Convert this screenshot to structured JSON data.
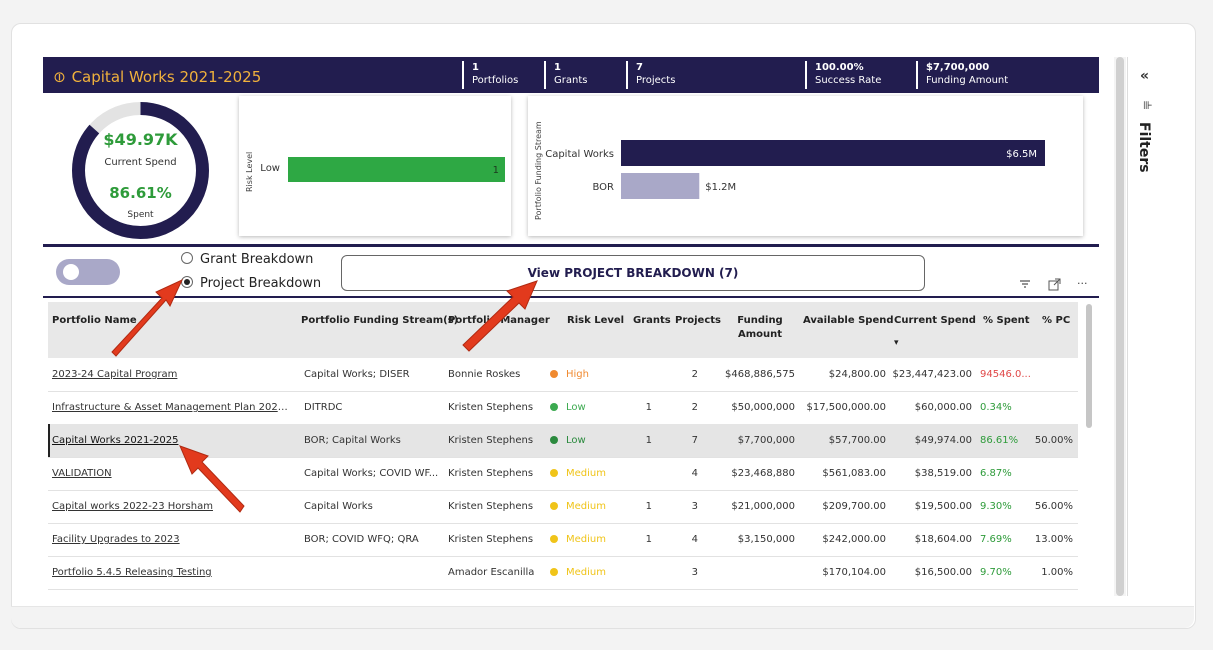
{
  "header": {
    "title": "Capital Works 2021-2025",
    "stats": [
      {
        "value": "1",
        "label": "Portfolios"
      },
      {
        "value": "1",
        "label": "Grants"
      },
      {
        "value": "7",
        "label": "Projects"
      },
      {
        "value": "100.00%",
        "label": "Success Rate"
      },
      {
        "value": "$7,700,000",
        "label": "Funding Amount"
      }
    ]
  },
  "donut": {
    "value": "$49.97K",
    "value_label": "Current Spend",
    "percent": "86.61%",
    "percent_label": "Spent",
    "fraction": 0.8661
  },
  "chart_data": [
    {
      "type": "bar",
      "orientation": "horizontal",
      "ylabel": "Risk Level",
      "categories": [
        "Low"
      ],
      "values": [
        1
      ],
      "data_labels": [
        "1"
      ],
      "xlim": [
        0,
        1
      ],
      "color": "#2ea844"
    },
    {
      "type": "bar",
      "orientation": "horizontal",
      "ylabel": "Portfolio Funding Stream",
      "categories": [
        "Capital Works",
        "BOR"
      ],
      "values": [
        6.5,
        1.2
      ],
      "data_labels": [
        "$6.5M",
        "$1.2M"
      ],
      "xlim": [
        0,
        6.5
      ],
      "colors": [
        "#221d4f",
        "#a9a8c8"
      ]
    }
  ],
  "controls": {
    "radio_grant": "Grant Breakdown",
    "radio_project": "Project Breakdown",
    "view_button": "View PROJECT BREAKDOWN (7)"
  },
  "toolbar": {
    "filter_icon": "filter-icon",
    "focus_icon": "focus-mode-icon",
    "more_icon": "more-options-icon",
    "more": "···"
  },
  "table": {
    "columns": [
      "Portfolio Name",
      "Portfolio Funding Stream(s)",
      "Portfolio Manager",
      "Risk Level",
      "Grants",
      "Projects",
      "Funding Amount",
      "Available Spend",
      "Current Spend",
      "% Spent",
      "% PC"
    ],
    "rows": [
      {
        "name": "2023-24 Capital Program",
        "stream": "Capital Works; DISER",
        "manager": "Bonnie Roskes",
        "risk": "High",
        "risk_color": "#f08a30",
        "grants": "",
        "projects": "2",
        "funding": "$468,886,575",
        "available": "$24,800.00",
        "current": "$23,447,423.00",
        "spent": "94546.0...",
        "spent_color": "#e04848",
        "pc": ""
      },
      {
        "name": "Infrastructure & Asset Management Plan 2022...",
        "stream": "DITRDC",
        "manager": "Kristen Stephens",
        "risk": "Low",
        "risk_color": "#3caa50",
        "grants": "1",
        "projects": "2",
        "funding": "$50,000,000",
        "available": "$17,500,000.00",
        "current": "$60,000.00",
        "spent": "0.34%",
        "spent_color": "#2e9b3a",
        "pc": ""
      },
      {
        "name": "Capital Works 2021-2025",
        "stream": "BOR; Capital Works",
        "manager": "Kristen Stephens",
        "risk": "Low",
        "risk_color": "#2b8a3e",
        "grants": "1",
        "projects": "7",
        "funding": "$7,700,000",
        "available": "$57,700.00",
        "current": "$49,974.00",
        "spent": "86.61%",
        "spent_color": "#2e9b3a",
        "pc": "50.00%",
        "selected": true
      },
      {
        "name": "VALIDATION",
        "stream": "Capital Works; COVID WF...",
        "manager": "Kristen Stephens",
        "risk": "Medium",
        "risk_color": "#f0c419",
        "grants": "",
        "projects": "4",
        "funding": "$23,468,880",
        "available": "$561,083.00",
        "current": "$38,519.00",
        "spent": "6.87%",
        "spent_color": "#2e9b3a",
        "pc": ""
      },
      {
        "name": "Capital works 2022-23 Horsham",
        "stream": "Capital Works",
        "manager": "Kristen Stephens",
        "risk": "Medium",
        "risk_color": "#f0c419",
        "grants": "1",
        "projects": "3",
        "funding": "$21,000,000",
        "available": "$209,700.00",
        "current": "$19,500.00",
        "spent": "9.30%",
        "spent_color": "#2e9b3a",
        "pc": "56.00%"
      },
      {
        "name": "Facility Upgrades to 2023",
        "stream": "BOR; COVID WFQ; QRA",
        "manager": "Kristen Stephens",
        "risk": "Medium",
        "risk_color": "#f0c419",
        "grants": "1",
        "projects": "4",
        "funding": "$3,150,000",
        "available": "$242,000.00",
        "current": "$18,604.00",
        "spent": "7.69%",
        "spent_color": "#2e9b3a",
        "pc": "13.00%"
      },
      {
        "name": "Portfolio 5.4.5 Releasing Testing",
        "stream": "",
        "manager": "Amador Escanilla",
        "risk": "Medium",
        "risk_color": "#f0c419",
        "grants": "",
        "projects": "3",
        "funding": "",
        "available": "$170,104.00",
        "current": "$16,500.00",
        "spent": "9.70%",
        "spent_color": "#2e9b3a",
        "pc": "1.00%"
      }
    ]
  },
  "side_panel": {
    "label": "Filters",
    "collapse": "«",
    "filter_glyph": "⊪"
  }
}
